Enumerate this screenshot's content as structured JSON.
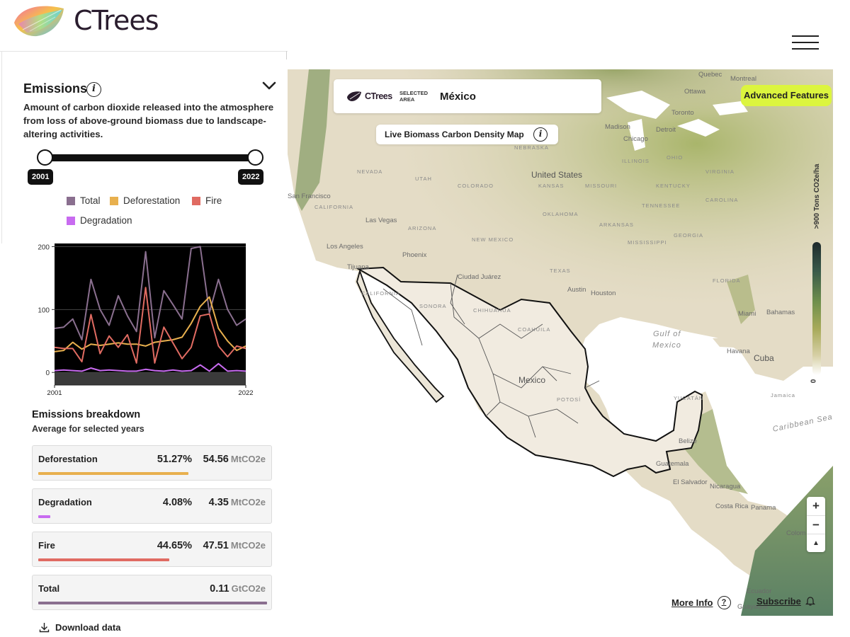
{
  "header": {
    "brand": "CTrees",
    "menu_icon": "hamburger-icon"
  },
  "panel": {
    "title": "Emissions",
    "description": "Amount of carbon dioxide released into the atmosphere from loss of above-ground biomass due to landscape-altering activities.",
    "year_start": "2001",
    "year_end": "2022",
    "legend": [
      {
        "label": "Total",
        "color": "#8a6f8f"
      },
      {
        "label": "Deforestation",
        "color": "#e8b04e"
      },
      {
        "label": "Fire",
        "color": "#e06b62"
      },
      {
        "label": "Degradation",
        "color": "#c86bf0"
      }
    ],
    "breakdown_title": "Emissions breakdown",
    "breakdown_subtitle": "Average for selected years",
    "breakdown": [
      {
        "name": "Deforestation",
        "pct": "51.27%",
        "value": "54.56",
        "unit": "MtCO2e",
        "share": 0.5127,
        "color": "#e8b04e"
      },
      {
        "name": "Degradation",
        "pct": "4.08%",
        "value": "4.35",
        "unit": "MtCO2e",
        "share": 0.0408,
        "color": "#c86bf0"
      },
      {
        "name": "Fire",
        "pct": "44.65%",
        "value": "47.51",
        "unit": "MtCO2e",
        "share": 0.4465,
        "color": "#e06b62"
      },
      {
        "name": "Total",
        "pct": "",
        "value": "0.11",
        "unit": "GtCO2e",
        "share": 1.0,
        "color": "#8a6f8f"
      }
    ],
    "download_label": "Download data"
  },
  "chart_data": {
    "type": "line",
    "x": [
      2001,
      2002,
      2003,
      2004,
      2005,
      2006,
      2007,
      2008,
      2009,
      2010,
      2011,
      2012,
      2013,
      2014,
      2015,
      2016,
      2017,
      2018,
      2019,
      2020,
      2021,
      2022
    ],
    "x_tick_labels": [
      "2001",
      "2022"
    ],
    "y_ticks": [
      0,
      100,
      200
    ],
    "ylim": [
      -20,
      205
    ],
    "series": [
      {
        "name": "Total",
        "color": "#8a6f8f",
        "values": [
          70,
          72,
          85,
          52,
          148,
          100,
          75,
          122,
          90,
          65,
          192,
          55,
          130,
          108,
          85,
          197,
          200,
          95,
          148,
          100,
          75,
          85
        ]
      },
      {
        "name": "Deforestation",
        "color": "#e8b04e",
        "values": [
          33,
          35,
          48,
          37,
          45,
          43,
          45,
          47,
          45,
          45,
          42,
          48,
          50,
          52,
          56,
          78,
          105,
          120,
          70,
          50,
          35,
          42
        ]
      },
      {
        "name": "Fire",
        "color": "#e06b62",
        "values": [
          40,
          38,
          38,
          17,
          92,
          30,
          58,
          40,
          60,
          15,
          135,
          15,
          72,
          47,
          22,
          40,
          90,
          93,
          42,
          25,
          42,
          38
        ]
      },
      {
        "name": "Degradation",
        "color": "#c86bf0",
        "values": [
          3,
          4,
          3,
          2,
          7,
          3,
          4,
          3,
          2,
          2,
          5,
          3,
          2,
          4,
          2,
          3,
          12,
          2,
          14,
          2,
          3,
          2
        ]
      }
    ]
  },
  "map": {
    "area_brand": "CTrees",
    "selected_label_1": "SELECTED",
    "selected_label_2": "AREA",
    "selected_area": "México",
    "layer_title": "Live Biomass Carbon Density Map",
    "advanced_features": "Advanced Features",
    "legend_title": ">900 Tons CO2e/ha",
    "legend_min": "0",
    "zoom_in": "+",
    "zoom_out": "−",
    "compass": "▲",
    "more_info": "More Info",
    "subscribe": "Subscribe",
    "labels": {
      "quebec": "Quebec",
      "ottawa": "Ottawa",
      "montreal": "Montreal",
      "toronto": "Toronto",
      "detroit": "Detroit",
      "madison": "Madison",
      "chicago": "Chicago",
      "illinois": "ILLINOIS",
      "ohio": "OHIO",
      "nebraska": "NEBRASKA",
      "nevada": "NEVADA",
      "utah": "UTAH",
      "colorado": "COLORADO",
      "kansas": "KANSAS",
      "missouri": "MISSOURI",
      "kentucky": "KENTUCKY",
      "virginia": "VIRGINIA",
      "tennessee": "TENNESSEE",
      "carolina": "CAROLINA",
      "oklahoma": "OKLAHOMA",
      "arkansas": "ARKANSAS",
      "mississippi": "MISSISSIPPI",
      "georgia": "GEORGIA",
      "texas": "TEXAS",
      "arizona": "ARIZONA",
      "newmexico": "NEW MEXICO",
      "california": "CALIFORNIA",
      "florida": "FLORIDA",
      "austin": "Austin",
      "houston": "Houston",
      "lasvegas": "Las Vegas",
      "losangeles": "Los Angeles",
      "sanfrancisco": "San Francisco",
      "phoenix": "Phoenix",
      "tijuana": "Tijuana",
      "ciudadjuarez": "Ciudad Juárez",
      "sonora": "SONORA",
      "chihuahua": "CHIHUAHUA",
      "coahuila": "COAHUILA",
      "baja": "CALIFORNIA",
      "unitedstates": "United States",
      "mexico": "Mexico",
      "gulf": "Gulf of",
      "gulf2": "Mexico",
      "miami": "Miami",
      "bahamas": "Bahamas",
      "havana": "Havana",
      "cuba": "Cuba",
      "jamaica": "Jamaica",
      "caribbean": "Caribbean Sea",
      "belize": "Belize",
      "guatemala": "Guatemala",
      "elsalvador": "El Salvador",
      "nicaragua": "Nicaragua",
      "costarica": "Costa Rica",
      "panama": "Panama",
      "colombia": "Colom",
      "ecuador": "Ecuador",
      "guayaquil": "Guayaquil",
      "yucatan": "YUCATÁN",
      "potosi": "POTOSÍ"
    }
  }
}
